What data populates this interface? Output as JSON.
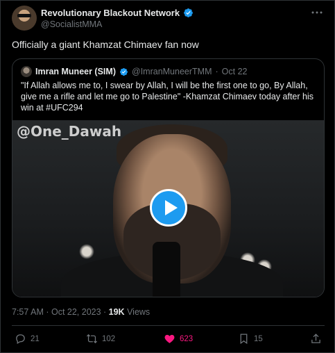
{
  "author": {
    "display_name": "Revolutionary Blackout Network",
    "handle": "@SocialistMMA"
  },
  "tweet": {
    "text": "Officially a giant Khamzat Chimaev fan now"
  },
  "quoted_tweet": {
    "author_name": "Imran Muneer (SIM)",
    "handle": "@ImranMuneerTMM",
    "date": "Oct 22",
    "text": "\"If Allah allows me to, I swear by Allah, I will be the first one to go, By Allah, give me a rifle and let me go to  Palestine\" -Khamzat Chimaev today after his win at #UFC294",
    "video_watermark": "@One_Dawah"
  },
  "meta": {
    "timestamp": "7:57 AM · Oct 22, 2023 · ",
    "views_count": "19K",
    "views_label": " Views"
  },
  "actions": {
    "replies": "21",
    "reposts": "102",
    "likes": "623",
    "bookmarks": "15"
  },
  "colors": {
    "accent": "#1d9bf0",
    "like": "#f91880",
    "secondary_text": "#71767b",
    "border": "#2f3336"
  },
  "icons": [
    "verified-badge-icon",
    "more-icon",
    "play-icon",
    "reply-icon",
    "repost-icon",
    "like-icon",
    "bookmark-icon",
    "share-icon"
  ]
}
